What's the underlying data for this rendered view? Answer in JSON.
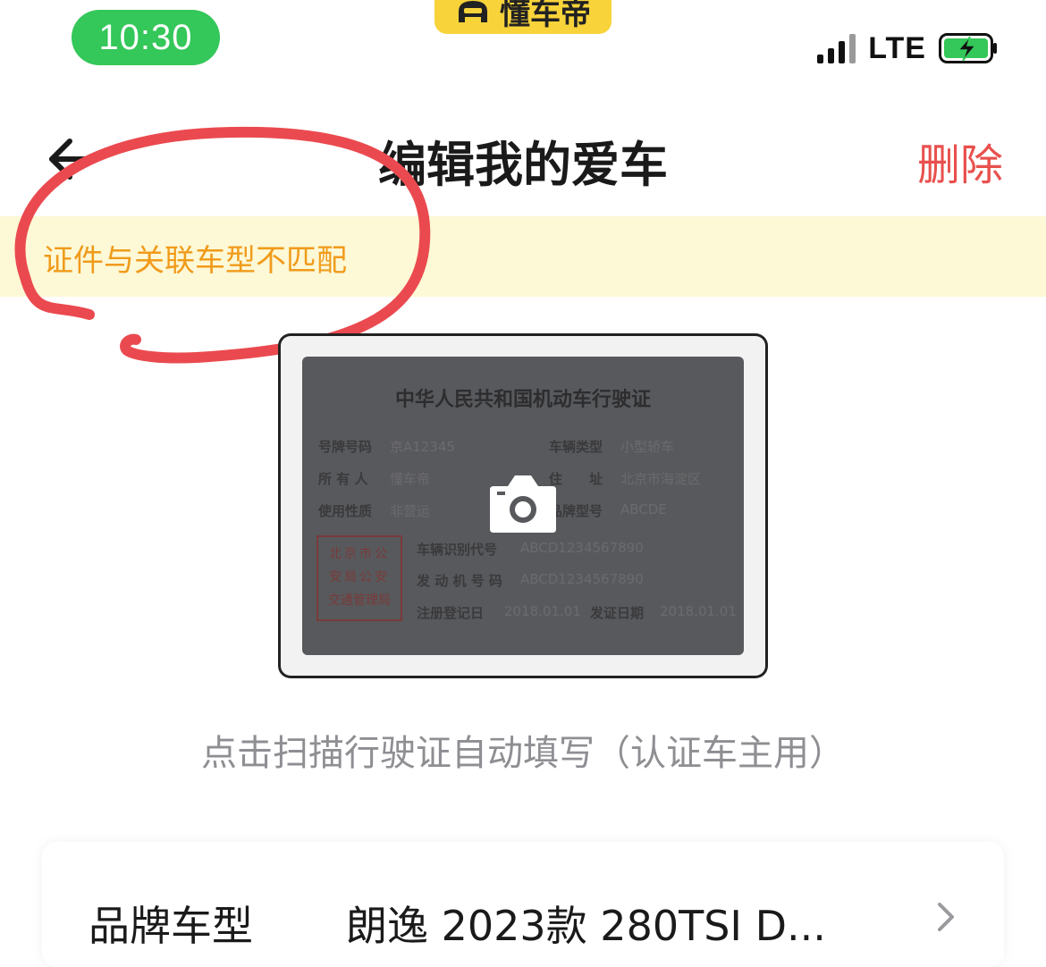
{
  "status_bar": {
    "time": "10:30",
    "app_tag": "懂车帝",
    "network": "LTE",
    "colors": {
      "time_pill": "#34c759",
      "app_tag": "#f8d33a",
      "battery": "#34c759"
    }
  },
  "nav": {
    "title": "编辑我的爱车",
    "delete_label": "删除",
    "icons": {
      "back": "chevron-left-icon"
    },
    "colors": {
      "delete": "#e8504d"
    }
  },
  "warning": {
    "text": "证件与关联车型不匹配",
    "colors": {
      "background": "#fdf8d6",
      "text": "#f09b1a",
      "annotation": "#e8504d"
    }
  },
  "license": {
    "title": "中华人民共和国机动车行驶证",
    "plate_label": "号牌号码",
    "plate_value": "京A12345",
    "vehicle_type_label": "车辆类型",
    "vehicle_type_value": "小型轿车",
    "owner_label": "所 有 人",
    "owner_value": "懂车帝",
    "address_label": "住　　址",
    "address_value": "北京市海淀区",
    "usage_label": "使用性质",
    "usage_value": "非营运",
    "model_label": "品牌型号",
    "model_value": "ABCDE",
    "vin_label": "车辆识别代号",
    "vin_value": "ABCD1234567890",
    "engine_label": "发 动 机 号 码",
    "engine_value": "ABCD1234567890",
    "register_label": "注册登记日",
    "register_value": "2018.01.01",
    "issue_label": "发证日期",
    "issue_value": "2018.01.01",
    "stamp_lines": [
      "北京市公",
      "安局公安",
      "交通管理局"
    ],
    "icon": "camera-icon"
  },
  "scan_hint": "点击扫描行驶证自动填写（认证车主用）",
  "form": {
    "rows": [
      {
        "label": "品牌车型",
        "value": "朗逸 2023款 280TSI D...",
        "icon": "chevron-right-icon"
      }
    ]
  }
}
